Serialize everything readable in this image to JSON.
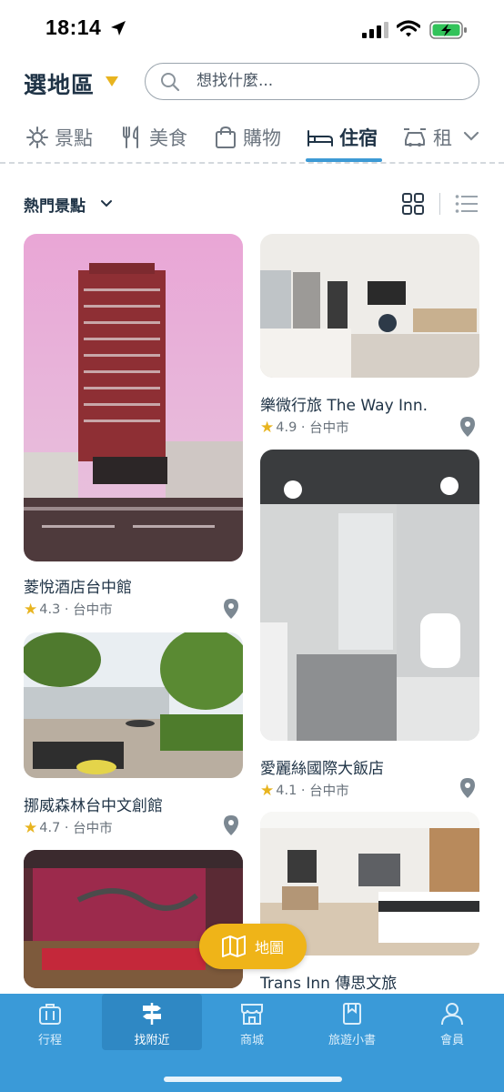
{
  "status_bar": {
    "time": "18:14"
  },
  "header": {
    "region_label": "選地區",
    "search_placeholder": "想找什麼..."
  },
  "categories": [
    {
      "label": "景點",
      "icon": "attraction-icon"
    },
    {
      "label": "美食",
      "icon": "food-icon"
    },
    {
      "label": "購物",
      "icon": "shopping-bag-icon"
    },
    {
      "label": "住宿",
      "icon": "bed-icon",
      "active": true
    },
    {
      "label": "租",
      "icon": "car-rental-icon"
    }
  ],
  "filter": {
    "label": "熱門景點"
  },
  "cards": [
    {
      "name": "菱悅酒店台中館",
      "rating": "4.3",
      "city": "台中市"
    },
    {
      "name": "樂微行旅 The Way Inn.",
      "rating": "4.9",
      "city": "台中市"
    },
    {
      "name": "挪威森林台中文創館",
      "rating": "4.7",
      "city": "台中市"
    },
    {
      "name": "愛麗絲國際大飯店",
      "rating": "4.1",
      "city": "台中市"
    },
    {
      "name": "",
      "rating": "",
      "city": ""
    },
    {
      "name": "Trans Inn 傳思文旅",
      "rating": "",
      "city": ""
    }
  ],
  "meta_separator": "·",
  "map_button": {
    "label": "地圖"
  },
  "bottom_nav": [
    {
      "label": "行程",
      "icon": "itinerary-icon"
    },
    {
      "label": "找附近",
      "icon": "signpost-icon",
      "active": true
    },
    {
      "label": "商城",
      "icon": "store-icon"
    },
    {
      "label": "旅遊小書",
      "icon": "travel-book-icon"
    },
    {
      "label": "會員",
      "icon": "member-icon"
    }
  ],
  "colors": {
    "accent_blue": "#3a9ad8",
    "accent_yellow": "#efb418",
    "text_dark": "#1f3346"
  }
}
